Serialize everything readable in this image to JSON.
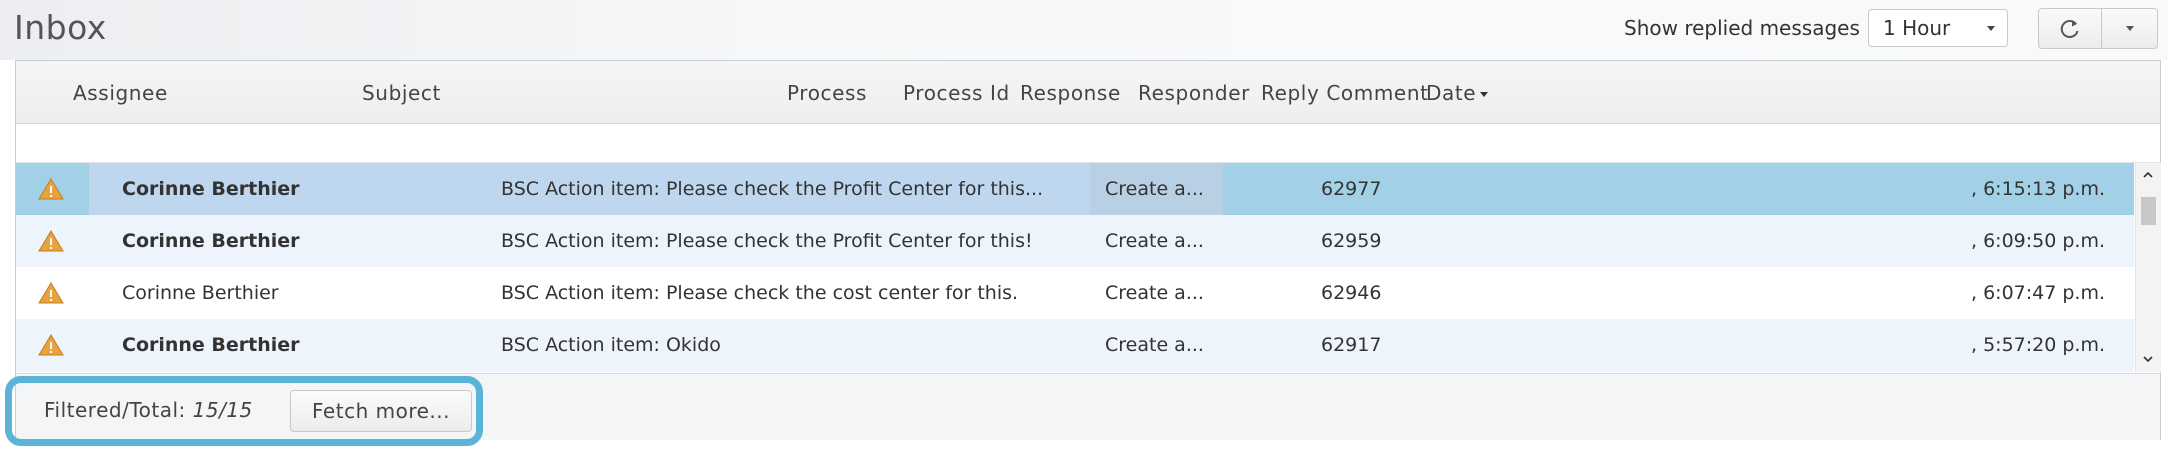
{
  "header": {
    "title": "Inbox",
    "replied_label": "Show replied messages",
    "replied_select_value": "1 Hour"
  },
  "columns": {
    "assignee": "Assignee",
    "subject": "Subject",
    "process": "Process",
    "process_id": "Process Id",
    "response": "Response",
    "responder": "Responder",
    "reply_comment": "Reply Comment",
    "date": "Date"
  },
  "rows": [
    {
      "assignee": "Corinne Berthier",
      "subject": "BSC Action item: Please check the Profit Center for this...",
      "process": "Create a...",
      "process_id": "62977",
      "date": ", 6:15:13 p.m.",
      "bold": true,
      "selected": true
    },
    {
      "assignee": "Corinne Berthier",
      "subject": "BSC Action item: Please check the Profit Center for this!",
      "process": "Create a...",
      "process_id": "62959",
      "date": ", 6:09:50 p.m.",
      "bold": true,
      "selected": false
    },
    {
      "assignee": "Corinne Berthier",
      "subject": "BSC Action item: Please check the cost center for this.",
      "process": "Create a...",
      "process_id": "62946",
      "date": ", 6:07:47 p.m.",
      "bold": false,
      "selected": false
    },
    {
      "assignee": "Corinne Berthier",
      "subject": "BSC Action item: Okido",
      "process": "Create a...",
      "process_id": "62917",
      "date": ", 5:57:20 p.m.",
      "bold": true,
      "selected": false
    }
  ],
  "footer": {
    "filtered_label": "Filtered/Total:",
    "filtered_value": "15/15",
    "fetch_more": "Fetch more..."
  },
  "colors": {
    "selected_row": "#a2d0e6",
    "alt_row": "#eef4fb",
    "warning_icon": "#e8a33d",
    "highlight_border": "#5bb3d7"
  },
  "icons": {
    "row_status": "warning-triangle-icon",
    "refresh": "refresh-icon",
    "sort": "sort-desc-icon"
  }
}
